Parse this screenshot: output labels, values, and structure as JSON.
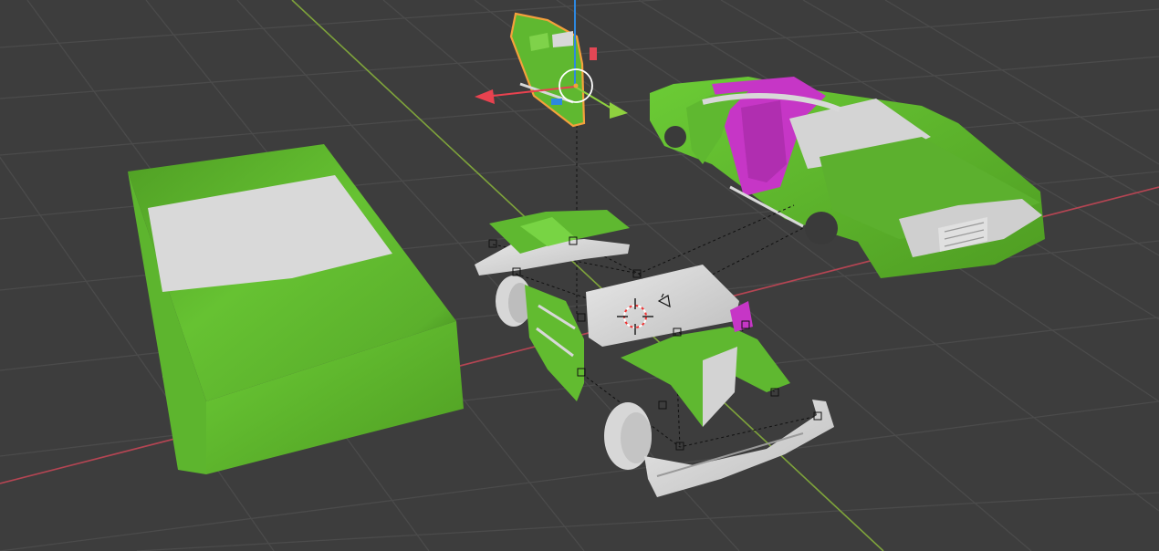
{
  "viewport": {
    "editor": "3d-viewport",
    "background_color": "#3d3d3d",
    "grid_color": "#4b4b4b",
    "x_axis_color": "#b54553",
    "y_axis_color": "#7ea33b",
    "selection_outline_color": "#f5a03c"
  },
  "objects": [
    {
      "name": "car-body-blockout",
      "color": "#5fb830"
    },
    {
      "name": "convertible-car-body",
      "color": "#5fb830"
    },
    {
      "name": "car-interior-seats",
      "color": "#c636c6"
    },
    {
      "name": "selected-car-door",
      "color": "#5fb830",
      "selected": true
    },
    {
      "name": "car-hood-part",
      "color": "#5fb830"
    },
    {
      "name": "car-windshield-part",
      "color": "#d8d8d8"
    },
    {
      "name": "car-side-door-part",
      "color": "#5fb830"
    },
    {
      "name": "car-front-fender-part",
      "color": "#5fb830"
    },
    {
      "name": "car-rear-bumper-part",
      "color": "#d8d8d8"
    },
    {
      "name": "car-front-bumper-part",
      "color": "#d8d8d8"
    },
    {
      "name": "car-wheel-rear",
      "color": "#d8d8d8"
    },
    {
      "name": "car-wheel-front",
      "color": "#d8d8d8"
    }
  ],
  "gizmo": {
    "x_handle_color": "#e8424f",
    "y_handle_color": "#8fd13f",
    "z_handle_color": "#2d88e0",
    "plane_handle_color": "#e24755"
  },
  "scene_icons": [
    "empty-icon",
    "camera-icon",
    "light-icon",
    "3d-cursor-icon"
  ]
}
